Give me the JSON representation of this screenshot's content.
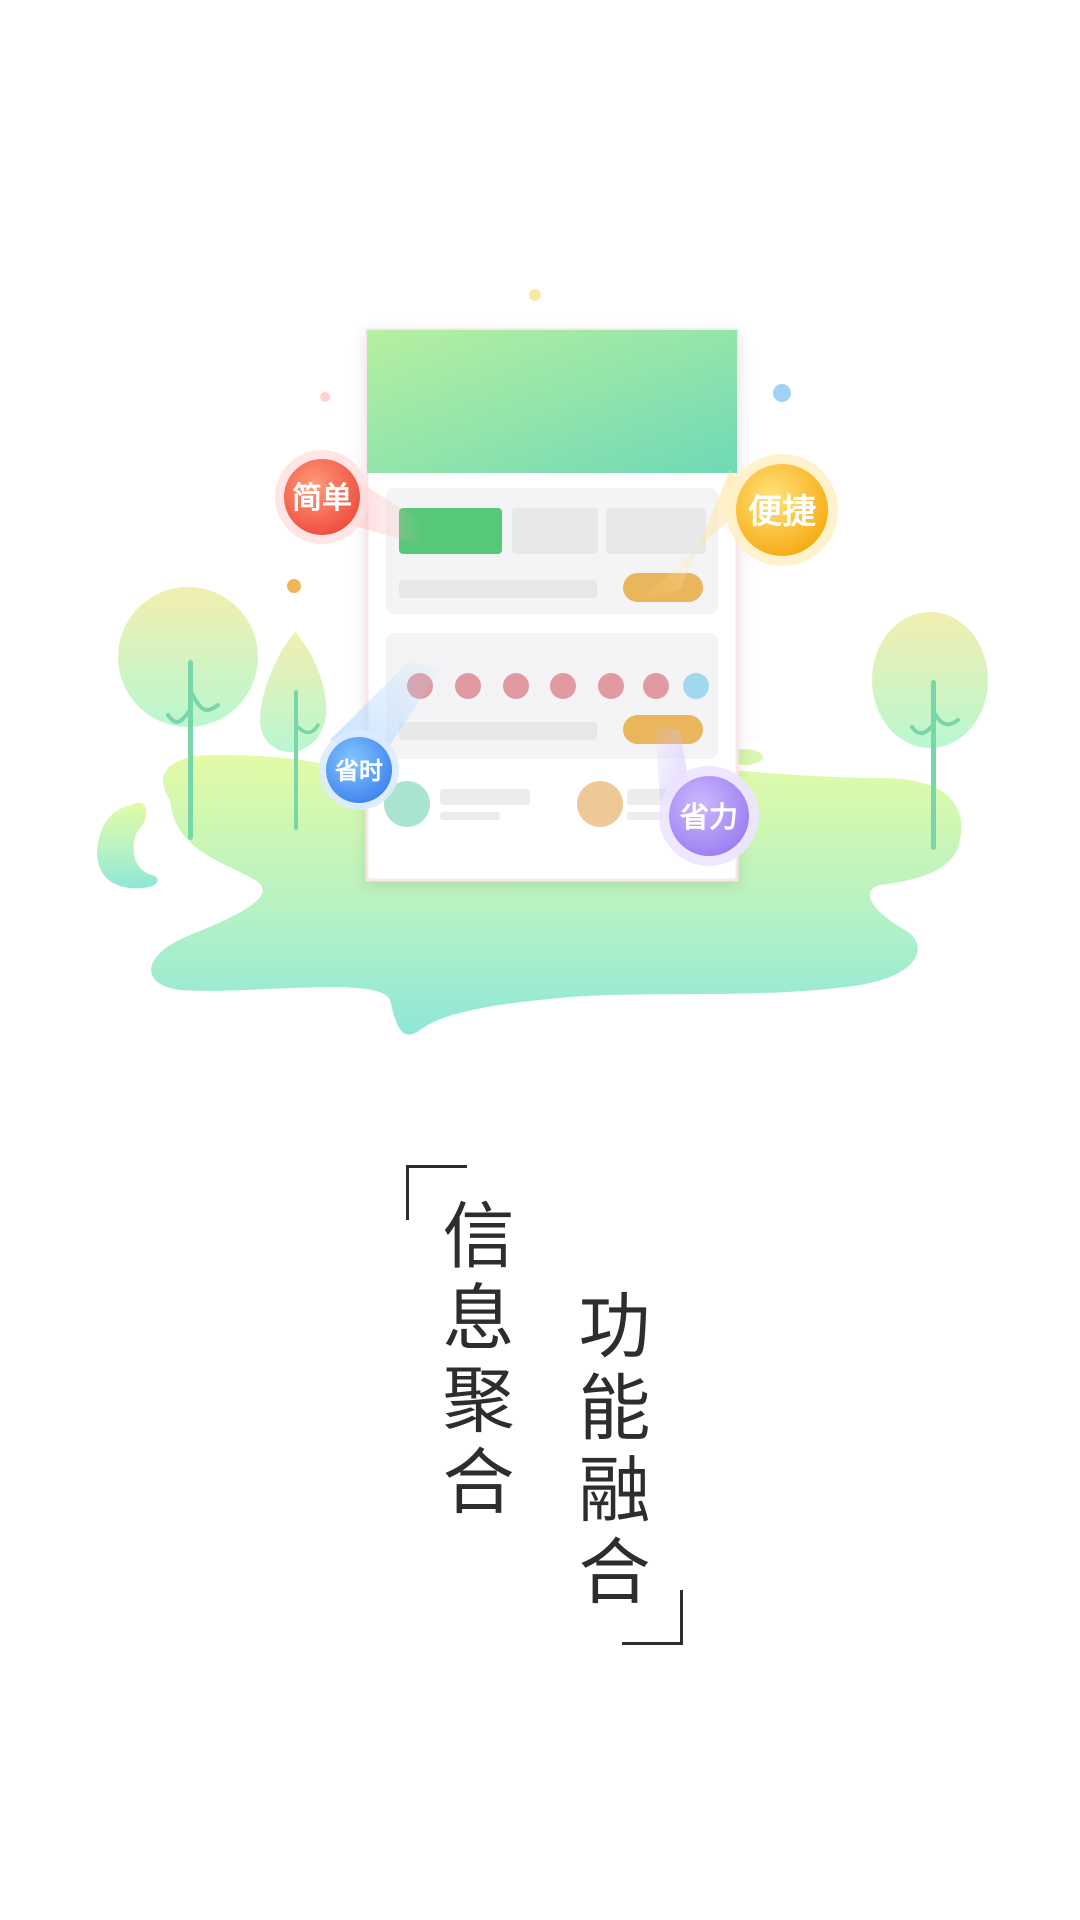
{
  "badges": {
    "simple": "简单",
    "convenient": "便捷",
    "save_time": "省时",
    "save_effort": "省力"
  },
  "slogan": {
    "line1": "信息聚合",
    "line2": "功能融合"
  },
  "colors": {
    "ink": "#2d2d2d",
    "card_header_start": "#b6f0a0",
    "card_header_end": "#6fd9b6",
    "primary_block": "#56c878",
    "pill_orange": "#e9b65c",
    "dot_pink": "#e19aa0",
    "dot_blue": "#9fd8ef",
    "badge_red": "#f05a4a",
    "badge_yellow": "#f8b81a",
    "badge_blue": "#4a8ff0",
    "badge_purple": "#a98cf0"
  }
}
